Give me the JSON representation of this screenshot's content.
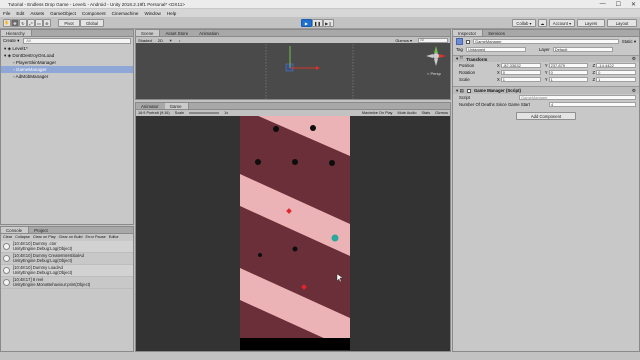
{
  "window": {
    "title": "Tutorial - Endless Drop Game - Level1 - Android - Unity 2018.2.19f1 Personal* <DX11>",
    "minimize": "—",
    "maximize": "☐",
    "close": "✕"
  },
  "menu": [
    "File",
    "Edit",
    "Assets",
    "GameObject",
    "Component",
    "Cinemachine",
    "Window",
    "Help"
  ],
  "toolbar": {
    "pivot_label": "Pivot",
    "space_label": "Global",
    "collab_label": "Collab ▾",
    "account_label": "Account ▾",
    "layers_label": "Layers",
    "layout_label": "Layout"
  },
  "hierarchy": {
    "tab": "Hierarchy",
    "create": "Create ▾",
    "search_placeholder": "All",
    "items": [
      {
        "label": "Level1*",
        "indent": 0
      },
      {
        "label": "DontDestroyOnLoad",
        "indent": 0
      },
      {
        "label": "PlayerSkinManager",
        "indent": 1
      },
      {
        "label": "GameManager",
        "indent": 1,
        "selected": true
      },
      {
        "label": "AdMobManager",
        "indent": 1
      }
    ]
  },
  "scene": {
    "tabs": [
      "Scene",
      "Asset Store",
      "Animation"
    ],
    "shading": "Shaded",
    "mode_2d": "2D",
    "gizmos": "Gizmos ▾",
    "search_placeholder": "All",
    "persp": "< Persp"
  },
  "game": {
    "tabs": [
      "Animator",
      "Game"
    ],
    "display": "Display 1",
    "aspect": "16:9 Portrait (9:16)",
    "scale_label": "Scale",
    "scale_value": "1x",
    "maximize": "Maximize On Play",
    "mute": "Mute Audio",
    "stats": "Stats",
    "gizmos": "Gizmos"
  },
  "console": {
    "tabs": [
      "Console",
      "Project"
    ],
    "buttons": [
      "Clear",
      "Collapse",
      "Clear on Play",
      "Clear on Build",
      "Error Pause",
      "Editor"
    ],
    "entries": [
      {
        "line1": "[10:48:10] Dummy .ctor",
        "line2": "UnityEngine.Debug:Log(Object)"
      },
      {
        "line1": "[10:48:10] Dummy CreateInterstitialAd",
        "line2": "UnityEngine.Debug:Log(Object)"
      },
      {
        "line1": "[10:48:10] Dummy LoadAd",
        "line2": "UnityEngine.Debug:Log(Object)"
      },
      {
        "line1": "[10:48:17] 8 reel",
        "line2": "UnityEngine.MonoBehaviour:print(Object)"
      }
    ]
  },
  "inspector": {
    "tabs": [
      "Inspector",
      "Services"
    ],
    "object_name": "GameManager",
    "static_label": "Static ▾",
    "tag_label": "Tag",
    "tag_value": "Untagged",
    "layer_label": "Layer",
    "layer_value": "Default",
    "transform_header": "Transform",
    "position_label": "Position",
    "rotation_label": "Rotation",
    "scale_label": "Scale",
    "position": {
      "x": "-82.33632",
      "y": "237.879",
      "z": "-14.4422"
    },
    "rotation": {
      "x": "0",
      "y": "0",
      "z": "0"
    },
    "scale": {
      "x": "1",
      "y": "1",
      "z": "1"
    },
    "axis_x": "X",
    "axis_y": "Y",
    "axis_z": "Z",
    "component_header": "Game Manager (Script)",
    "script_label": "Script",
    "script_value": "GameManager",
    "field_label": "Number Of Deaths Since Game Start",
    "field_value": "4",
    "add_component": "Add Component"
  },
  "colors": {
    "stripe_dark": "#6a2f38",
    "stripe_light": "#ecb3b6",
    "play_blue": "#1f6fd1",
    "selection": "#8fa7d6",
    "ball_teal": "#2aa89c",
    "enemy_red": "#e0262c"
  }
}
